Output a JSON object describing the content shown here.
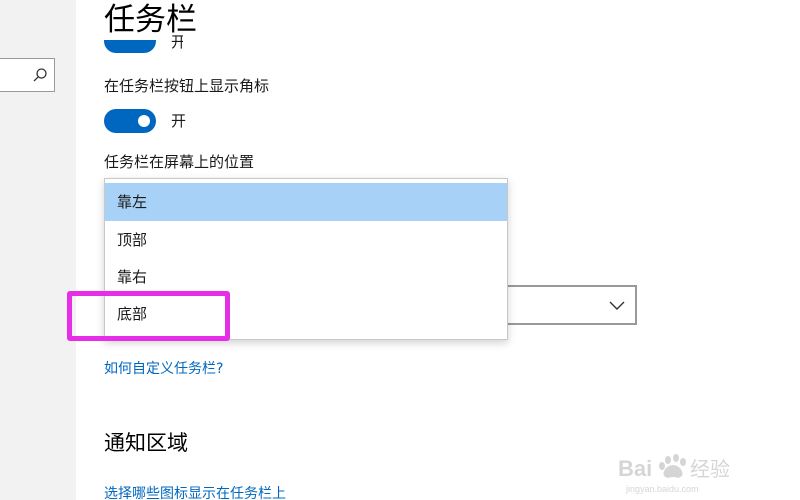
{
  "header": {
    "title": "任务栏"
  },
  "settings": {
    "partial_toggle_state": "开",
    "badges_label": "在任务栏按钮上显示角标",
    "badges_state": "开",
    "position_label": "任务栏在屏幕上的位置",
    "position_options": [
      "靠左",
      "顶部",
      "靠右",
      "底部"
    ],
    "position_selected": "靠左",
    "help_link": "如何自定义任务栏?"
  },
  "notification_area": {
    "title": "通知区域",
    "select_icons_link": "选择哪些图标显示在任务栏上"
  },
  "colors": {
    "accent": "#0067c0",
    "selected_option": "#a8d1f7",
    "annotation": "#e62ee6"
  },
  "watermark": {
    "text": "Baidu 经验"
  }
}
